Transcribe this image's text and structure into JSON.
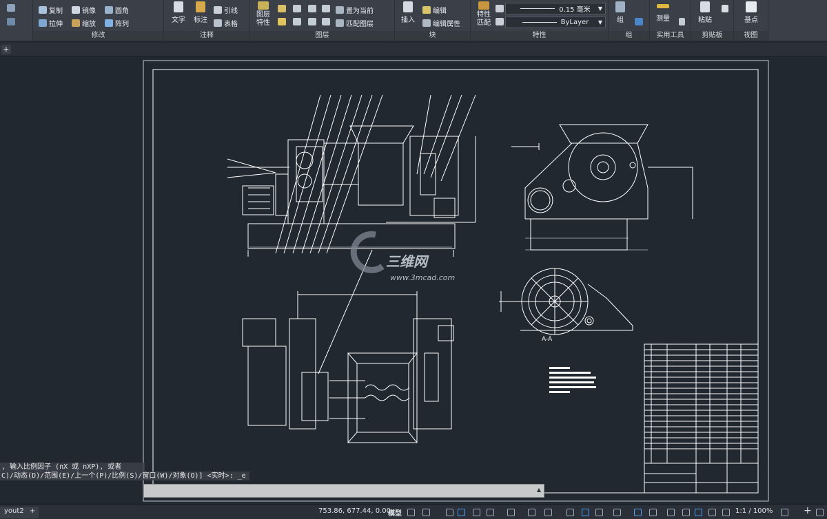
{
  "ribbon": {
    "modify": {
      "title": "修改",
      "items": [
        "复制",
        "镜像",
        "圆角",
        "拉伸",
        "缩放",
        "阵列"
      ]
    },
    "annotation": {
      "title": "注释",
      "text_label": "文字",
      "dimension_label": "标注",
      "leader_label": "引线",
      "table_label": "表格"
    },
    "layers": {
      "title": "图层",
      "layer_props_label": "图层\n特性",
      "set_current_label": "置为当前",
      "match_layer_label": "匹配图层"
    },
    "block": {
      "title": "块",
      "insert_label": "插入",
      "edit_label": "编辑",
      "edit_attr_label": "编辑属性"
    },
    "properties": {
      "title": "特性",
      "match_label": "特性\n匹配",
      "lineweight_value": "0.15 毫米",
      "linetype_value": "ByLayer"
    },
    "groups": {
      "title": "组",
      "group_label": "组"
    },
    "utilities": {
      "title": "实用工具",
      "measure_label": "测量"
    },
    "clipboard": {
      "title": "剪贴板",
      "paste_label": "粘贴"
    },
    "view": {
      "title": "视图",
      "base_label": "基点"
    }
  },
  "watermark": {
    "brand_text": "三维网",
    "url_text": "www.3mcad.com"
  },
  "drawing_texts": {
    "section_label": "A-A"
  },
  "command": {
    "history_line1": ", 输入比例因子 (nX 或 nXP), 或者",
    "history_line2": "C)/动态(D)/范围(E)/上一个(P)/比例(S)/窗口(W)/对象(O)] <实时>: _e",
    "input_value": ""
  },
  "status": {
    "coordinates": "753.86, 677.44, 0.00",
    "model_label": "模型",
    "scale_label": "1:1 / 100%",
    "layout_tab": "yout2",
    "add_tab_glyph": "+"
  },
  "colors": {
    "background": "#212830",
    "ribbon": "#3b4048",
    "lines": "#ffffff",
    "status_blue": "#4aa3ff"
  }
}
